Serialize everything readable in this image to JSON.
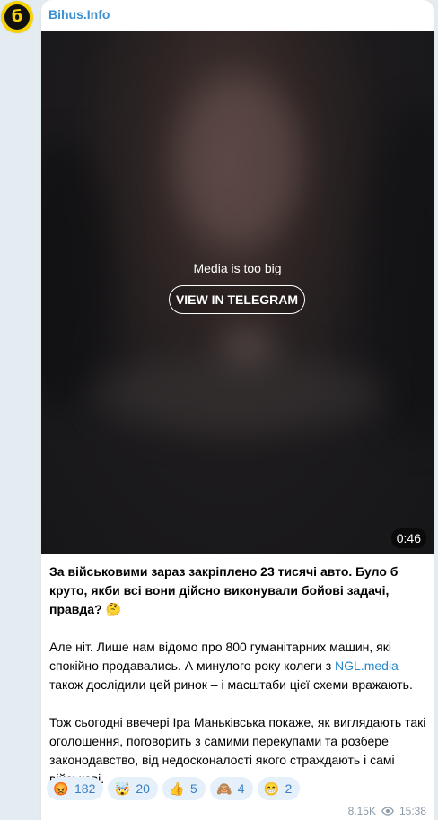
{
  "channel": {
    "name": "Bihus.Info",
    "avatar_letter": "б"
  },
  "media": {
    "notice": "Media is too big",
    "view_button": "VIEW IN TELEGRAM",
    "duration": "0:46"
  },
  "post": {
    "p1": "За військовими зараз закріплено 23 тисячі авто. Було б круто, якби всі вони дійсно виконували бойові задачі, правда? 🤔",
    "p2_before": "Але ніт. Лише нам відомо про 800 гуманітарних машин, які спокійно продавались. А минулого року колеги з ",
    "p2_link": "NGL.media",
    "p2_after": " також дослідили цей ринок – і масштаби цієї схеми вражають.",
    "p3": "Тож сьогодні ввечері Іра Маньківська покаже, як виглядають такі оголошення, поговорить з самими перекупами та розбере законодавство, від недосконалості якого страждають і самі військові."
  },
  "reactions": [
    {
      "emoji": "😡",
      "count": "182"
    },
    {
      "emoji": "🤯",
      "count": "20"
    },
    {
      "emoji": "👍",
      "count": "5"
    },
    {
      "emoji": "🙈",
      "count": "4"
    },
    {
      "emoji": "😁",
      "count": "2"
    }
  ],
  "meta": {
    "views": "8.15K",
    "time": "15:38"
  },
  "colors": {
    "accent": "#3d8fd0",
    "link": "#2a86c8",
    "background": "#e4ecf1"
  }
}
